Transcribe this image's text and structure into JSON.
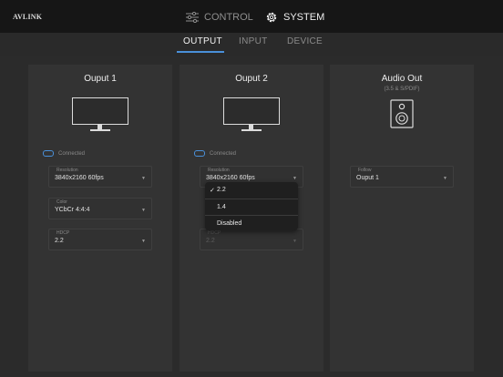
{
  "app": {
    "logo": "AVLINK"
  },
  "topnav": {
    "control_label": "CONTROL",
    "system_label": "SYSTEM"
  },
  "tabs": [
    {
      "label": "OUTPUT",
      "active": true
    },
    {
      "label": "INPUT",
      "active": false
    },
    {
      "label": "DEVICE",
      "active": false
    }
  ],
  "panels": [
    {
      "title": "Ouput 1",
      "status": "Connected",
      "fields": [
        {
          "label": "Resolution",
          "value": "3840x2160 60fps"
        },
        {
          "label": "Color",
          "value": "YCbCr 4:4:4"
        },
        {
          "label": "HDCP",
          "value": "2.2"
        }
      ]
    },
    {
      "title": "Ouput 2",
      "status": "Connected",
      "fields": [
        {
          "label": "Resolution",
          "value": "3840x2160 60fps"
        },
        {
          "label": "HDCP",
          "value": "2.2"
        }
      ],
      "dropdown": {
        "checkmark": "✓",
        "options": [
          "2.2",
          "1.4",
          "Disabled"
        ],
        "selected": "2.2"
      }
    },
    {
      "title": "Audio Out",
      "subtitle": "(3.5 & S/PDIF)",
      "fields": [
        {
          "label": "Follow",
          "value": "Ouput 1"
        }
      ]
    }
  ],
  "colors": {
    "accent": "#4a90d9",
    "topbar": "#161616",
    "panel": "#333333",
    "background": "#2b2b2b"
  }
}
